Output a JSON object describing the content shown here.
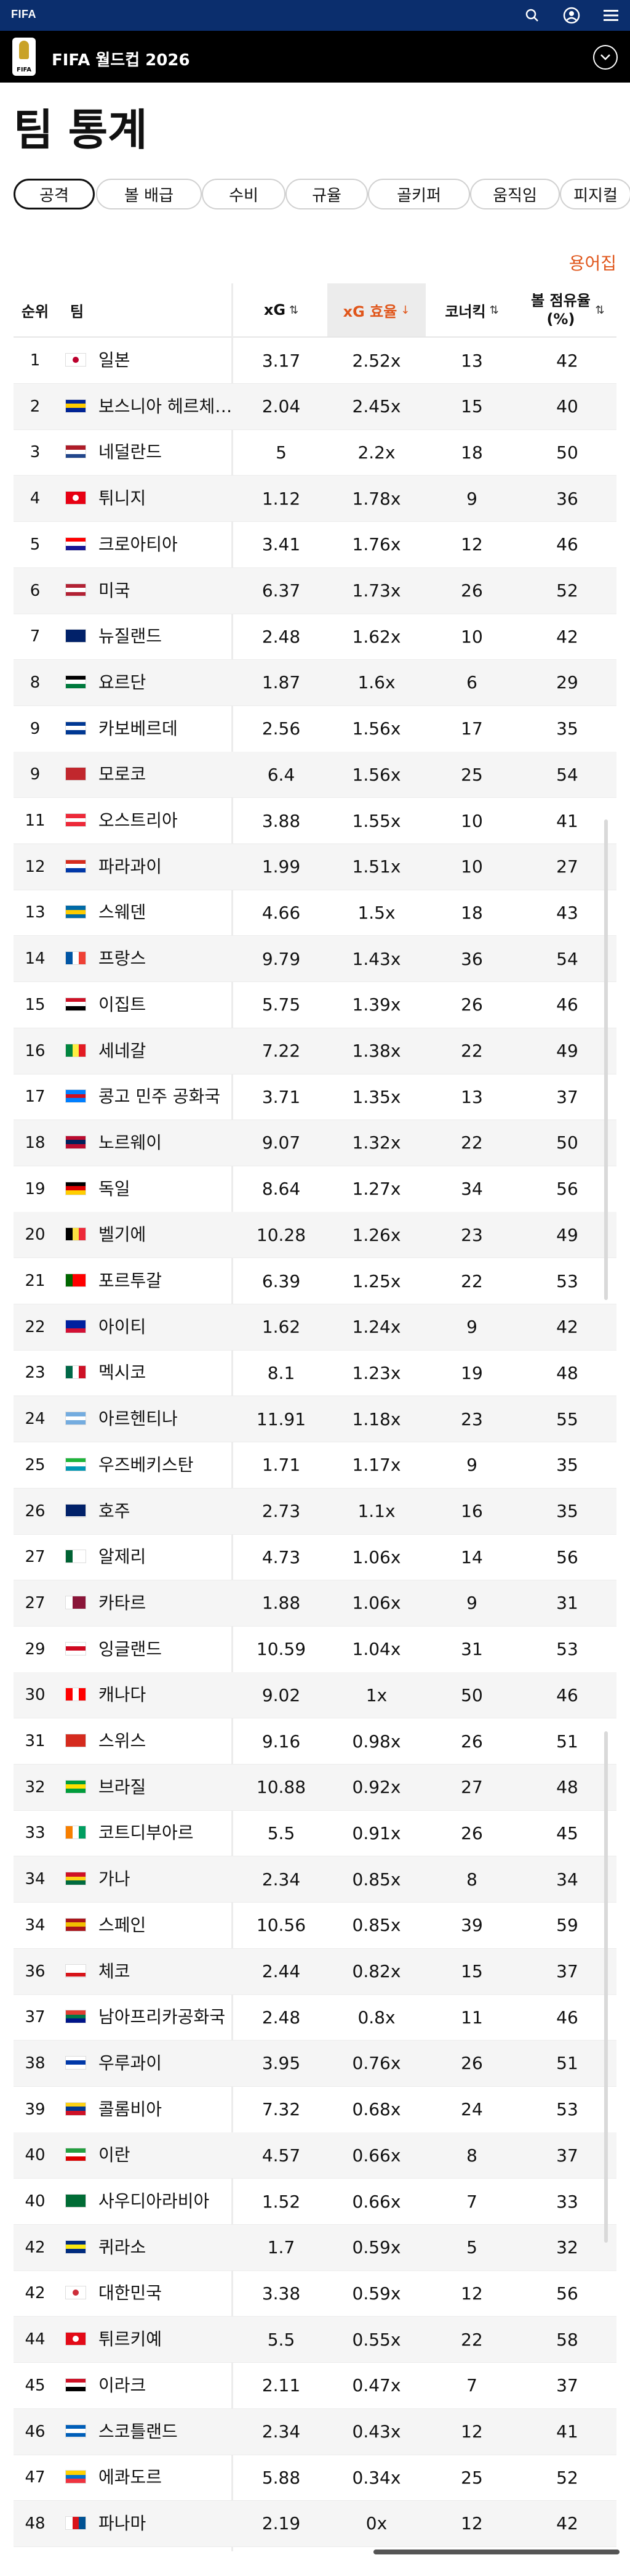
{
  "topbar": {
    "logo": "FIFA",
    "search_icon": "search-icon",
    "account_icon": "user-circle-icon",
    "menu_icon": "hamburger-menu-icon"
  },
  "subbar": {
    "title": "FIFA 월드컵 2026",
    "badge_text": "FIFA",
    "chevron_icon": "chevron-down-icon"
  },
  "page": {
    "title": "팀 통계",
    "glossary": "용어집"
  },
  "tabs": [
    "공격",
    "볼 배급",
    "수비",
    "규율",
    "골키퍼",
    "움직임",
    "피지컬"
  ],
  "table": {
    "headers": {
      "rank": "순위",
      "team": "팀",
      "xg": "xG",
      "xg_eff": "xG 효율",
      "corners": "코너킥",
      "possession": "볼 점유율 (%)"
    },
    "sort_icon": "sort-arrows-icon",
    "sorted_icon": "arrow-down-icon",
    "rows": [
      {
        "rank": "1",
        "team": "일본",
        "xg": "3.17",
        "eff": "2.52x",
        "corners": "13",
        "pos": "42",
        "flag": [
          "#ffffff",
          "#ffffff",
          "#ffffff"
        ],
        "dot": "#bc002d"
      },
      {
        "rank": "2",
        "team": "보스니아 헤르체고비나",
        "xg": "2.04",
        "eff": "2.45x",
        "corners": "15",
        "pos": "40",
        "flag": [
          "#002395",
          "#fecb00",
          "#002395"
        ]
      },
      {
        "rank": "3",
        "team": "네덜란드",
        "xg": "5",
        "eff": "2.2x",
        "corners": "18",
        "pos": "50",
        "flag": [
          "#ae1c28",
          "#ffffff",
          "#21468b"
        ]
      },
      {
        "rank": "4",
        "team": "튀니지",
        "xg": "1.12",
        "eff": "1.78x",
        "corners": "9",
        "pos": "36",
        "flag": [
          "#e70013",
          "#e70013",
          "#e70013"
        ],
        "dot": "#ffffff"
      },
      {
        "rank": "5",
        "team": "크로아티아",
        "xg": "3.41",
        "eff": "1.76x",
        "corners": "12",
        "pos": "46",
        "flag": [
          "#ff0000",
          "#ffffff",
          "#171796"
        ]
      },
      {
        "rank": "6",
        "team": "미국",
        "xg": "6.37",
        "eff": "1.73x",
        "corners": "26",
        "pos": "52",
        "flag": [
          "#b22234",
          "#ffffff",
          "#b22234"
        ]
      },
      {
        "rank": "7",
        "team": "뉴질랜드",
        "xg": "2.48",
        "eff": "1.62x",
        "corners": "10",
        "pos": "42",
        "flag": [
          "#012169",
          "#012169",
          "#012169"
        ]
      },
      {
        "rank": "8",
        "team": "요르단",
        "xg": "1.87",
        "eff": "1.6x",
        "corners": "6",
        "pos": "29",
        "flag": [
          "#000000",
          "#ffffff",
          "#007a3d"
        ]
      },
      {
        "rank": "9",
        "team": "카보베르데",
        "xg": "2.56",
        "eff": "1.56x",
        "corners": "17",
        "pos": "35",
        "flag": [
          "#003893",
          "#ffffff",
          "#003893"
        ]
      },
      {
        "rank": "9",
        "team": "모로코",
        "xg": "6.4",
        "eff": "1.56x",
        "corners": "25",
        "pos": "54",
        "flag": [
          "#c1272d",
          "#c1272d",
          "#c1272d"
        ]
      },
      {
        "rank": "11",
        "team": "오스트리아",
        "xg": "3.88",
        "eff": "1.55x",
        "corners": "10",
        "pos": "41",
        "flag": [
          "#ed2939",
          "#ffffff",
          "#ed2939"
        ]
      },
      {
        "rank": "12",
        "team": "파라과이",
        "xg": "1.99",
        "eff": "1.51x",
        "corners": "10",
        "pos": "27",
        "flag": [
          "#d52b1e",
          "#ffffff",
          "#0038a8"
        ]
      },
      {
        "rank": "13",
        "team": "스웨덴",
        "xg": "4.66",
        "eff": "1.5x",
        "corners": "18",
        "pos": "43",
        "flag": [
          "#006aa7",
          "#fecc00",
          "#006aa7"
        ]
      },
      {
        "rank": "14",
        "team": "프랑스",
        "xg": "9.79",
        "eff": "1.43x",
        "corners": "36",
        "pos": "54",
        "flag": [
          "#0055a4",
          "#ffffff",
          "#ef4135"
        ],
        "vertical": true
      },
      {
        "rank": "15",
        "team": "이집트",
        "xg": "5.75",
        "eff": "1.39x",
        "corners": "26",
        "pos": "46",
        "flag": [
          "#ce1126",
          "#ffffff",
          "#000000"
        ]
      },
      {
        "rank": "16",
        "team": "세네갈",
        "xg": "7.22",
        "eff": "1.38x",
        "corners": "22",
        "pos": "49",
        "flag": [
          "#00853f",
          "#fdef42",
          "#e31b23"
        ],
        "vertical": true
      },
      {
        "rank": "17",
        "team": "콩고 민주 공화국",
        "xg": "3.71",
        "eff": "1.35x",
        "corners": "13",
        "pos": "37",
        "flag": [
          "#007fff",
          "#ce1021",
          "#007fff"
        ]
      },
      {
        "rank": "18",
        "team": "노르웨이",
        "xg": "9.07",
        "eff": "1.32x",
        "corners": "22",
        "pos": "50",
        "flag": [
          "#ba0c2f",
          "#00205b",
          "#ba0c2f"
        ]
      },
      {
        "rank": "19",
        "team": "독일",
        "xg": "8.64",
        "eff": "1.27x",
        "corners": "34",
        "pos": "56",
        "flag": [
          "#000000",
          "#dd0000",
          "#ffce00"
        ]
      },
      {
        "rank": "20",
        "team": "벨기에",
        "xg": "10.28",
        "eff": "1.26x",
        "corners": "23",
        "pos": "49",
        "flag": [
          "#000000",
          "#fae042",
          "#ed2939"
        ],
        "vertical": true
      },
      {
        "rank": "21",
        "team": "포르투갈",
        "xg": "6.39",
        "eff": "1.25x",
        "corners": "22",
        "pos": "53",
        "flag": [
          "#006600",
          "#ff0000",
          "#ff0000"
        ],
        "vertical": true
      },
      {
        "rank": "22",
        "team": "아이티",
        "xg": "1.62",
        "eff": "1.24x",
        "corners": "9",
        "pos": "42",
        "flag": [
          "#00209f",
          "#00209f",
          "#d21034"
        ]
      },
      {
        "rank": "23",
        "team": "멕시코",
        "xg": "8.1",
        "eff": "1.23x",
        "corners": "19",
        "pos": "48",
        "flag": [
          "#006847",
          "#ffffff",
          "#ce1126"
        ],
        "vertical": true
      },
      {
        "rank": "24",
        "team": "아르헨티나",
        "xg": "11.91",
        "eff": "1.18x",
        "corners": "23",
        "pos": "55",
        "flag": [
          "#74acdf",
          "#ffffff",
          "#74acdf"
        ]
      },
      {
        "rank": "25",
        "team": "우즈베키스탄",
        "xg": "1.71",
        "eff": "1.17x",
        "corners": "9",
        "pos": "35",
        "flag": [
          "#1eb53a",
          "#ffffff",
          "#0099b5"
        ]
      },
      {
        "rank": "26",
        "team": "호주",
        "xg": "2.73",
        "eff": "1.1x",
        "corners": "16",
        "pos": "35",
        "flag": [
          "#012169",
          "#012169",
          "#012169"
        ]
      },
      {
        "rank": "27",
        "team": "알제리",
        "xg": "4.73",
        "eff": "1.06x",
        "corners": "14",
        "pos": "56",
        "flag": [
          "#006233",
          "#ffffff",
          "#ffffff"
        ],
        "vertical": true
      },
      {
        "rank": "27",
        "team": "카타르",
        "xg": "1.88",
        "eff": "1.06x",
        "corners": "9",
        "pos": "31",
        "flag": [
          "#ffffff",
          "#8a1538",
          "#8a1538"
        ],
        "vertical": true
      },
      {
        "rank": "29",
        "team": "잉글랜드",
        "xg": "10.59",
        "eff": "1.04x",
        "corners": "31",
        "pos": "53",
        "flag": [
          "#ffffff",
          "#cf081f",
          "#ffffff"
        ]
      },
      {
        "rank": "30",
        "team": "캐나다",
        "xg": "9.02",
        "eff": "1x",
        "corners": "50",
        "pos": "46",
        "flag": [
          "#ff0000",
          "#ffffff",
          "#ff0000"
        ],
        "vertical": true
      },
      {
        "rank": "31",
        "team": "스위스",
        "xg": "9.16",
        "eff": "0.98x",
        "corners": "26",
        "pos": "51",
        "flag": [
          "#d52b1e",
          "#d52b1e",
          "#d52b1e"
        ]
      },
      {
        "rank": "32",
        "team": "브라질",
        "xg": "10.88",
        "eff": "0.92x",
        "corners": "27",
        "pos": "48",
        "flag": [
          "#009c3b",
          "#ffdf00",
          "#009c3b"
        ]
      },
      {
        "rank": "33",
        "team": "코트디부아르",
        "xg": "5.5",
        "eff": "0.91x",
        "corners": "26",
        "pos": "45",
        "flag": [
          "#f77f00",
          "#ffffff",
          "#009e60"
        ],
        "vertical": true
      },
      {
        "rank": "34",
        "team": "가나",
        "xg": "2.34",
        "eff": "0.85x",
        "corners": "8",
        "pos": "34",
        "flag": [
          "#ce1126",
          "#fcd116",
          "#006b3f"
        ]
      },
      {
        "rank": "34",
        "team": "스페인",
        "xg": "10.56",
        "eff": "0.85x",
        "corners": "39",
        "pos": "59",
        "flag": [
          "#aa151b",
          "#f1bf00",
          "#aa151b"
        ]
      },
      {
        "rank": "36",
        "team": "체코",
        "xg": "2.44",
        "eff": "0.82x",
        "corners": "15",
        "pos": "37",
        "flag": [
          "#ffffff",
          "#ffffff",
          "#d7141a"
        ]
      },
      {
        "rank": "37",
        "team": "남아프리카공화국",
        "xg": "2.48",
        "eff": "0.8x",
        "corners": "11",
        "pos": "46",
        "flag": [
          "#e03c31",
          "#007749",
          "#001489"
        ]
      },
      {
        "rank": "38",
        "team": "우루과이",
        "xg": "3.95",
        "eff": "0.76x",
        "corners": "26",
        "pos": "51",
        "flag": [
          "#ffffff",
          "#0038a8",
          "#ffffff"
        ]
      },
      {
        "rank": "39",
        "team": "콜롬비아",
        "xg": "7.32",
        "eff": "0.68x",
        "corners": "24",
        "pos": "53",
        "flag": [
          "#fcd116",
          "#003893",
          "#ce1126"
        ]
      },
      {
        "rank": "40",
        "team": "이란",
        "xg": "4.57",
        "eff": "0.66x",
        "corners": "8",
        "pos": "37",
        "flag": [
          "#239f40",
          "#ffffff",
          "#da0000"
        ]
      },
      {
        "rank": "40",
        "team": "사우디아라비아",
        "xg": "1.52",
        "eff": "0.66x",
        "corners": "7",
        "pos": "33",
        "flag": [
          "#006c35",
          "#006c35",
          "#006c35"
        ]
      },
      {
        "rank": "42",
        "team": "퀴라소",
        "xg": "1.7",
        "eff": "0.59x",
        "corners": "5",
        "pos": "32",
        "flag": [
          "#002b7f",
          "#f9e814",
          "#002b7f"
        ]
      },
      {
        "rank": "42",
        "team": "대한민국",
        "xg": "3.38",
        "eff": "0.59x",
        "corners": "12",
        "pos": "56",
        "flag": [
          "#ffffff",
          "#ffffff",
          "#ffffff"
        ],
        "dot": "#cd2e3a"
      },
      {
        "rank": "44",
        "team": "튀르키예",
        "xg": "5.5",
        "eff": "0.55x",
        "corners": "22",
        "pos": "58",
        "flag": [
          "#e30a17",
          "#e30a17",
          "#e30a17"
        ],
        "dot": "#ffffff"
      },
      {
        "rank": "45",
        "team": "이라크",
        "xg": "2.11",
        "eff": "0.47x",
        "corners": "7",
        "pos": "37",
        "flag": [
          "#ce1126",
          "#ffffff",
          "#000000"
        ]
      },
      {
        "rank": "46",
        "team": "스코틀랜드",
        "xg": "2.34",
        "eff": "0.43x",
        "corners": "12",
        "pos": "41",
        "flag": [
          "#005eb8",
          "#ffffff",
          "#005eb8"
        ]
      },
      {
        "rank": "47",
        "team": "에콰도르",
        "xg": "5.88",
        "eff": "0.34x",
        "corners": "25",
        "pos": "52",
        "flag": [
          "#ffd100",
          "#0072ce",
          "#ef3340"
        ]
      },
      {
        "rank": "48",
        "team": "파나마",
        "xg": "2.19",
        "eff": "0x",
        "corners": "12",
        "pos": "42",
        "flag": [
          "#ffffff",
          "#da121a",
          "#005293"
        ],
        "vertical": true
      }
    ]
  },
  "colors": {
    "accent": "#e0561b",
    "topbar": "#0b2e6d"
  }
}
